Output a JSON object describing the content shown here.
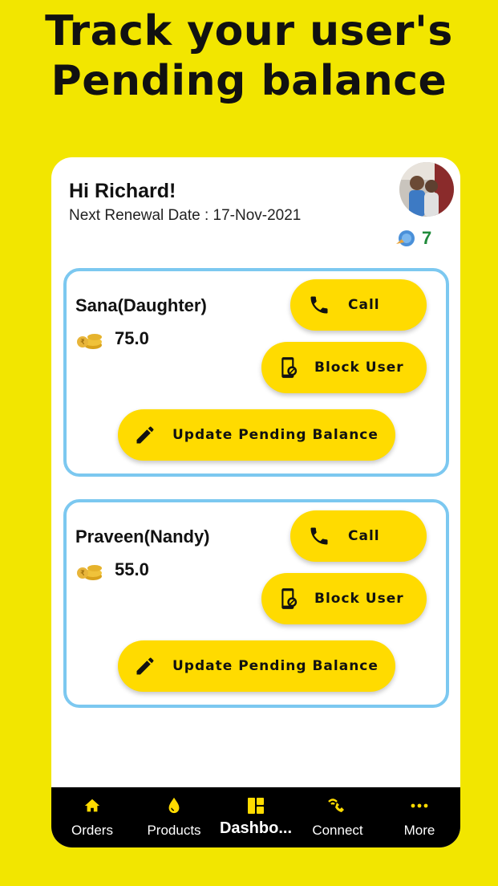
{
  "headline": {
    "line1": "Track your user's",
    "line2": "Pending balance"
  },
  "header": {
    "greeting": "Hi Richard!",
    "renewal": "Next Renewal Date : 17-Nov-2021",
    "points": "7"
  },
  "members": [
    {
      "name": "Sana(Daughter)",
      "balance": "75.0",
      "call_label": "Call",
      "block_label": "Block User",
      "update_label": "Update Pending Balance"
    },
    {
      "name": "Praveen(Nandy)",
      "balance": "55.0",
      "call_label": "Call",
      "block_label": "Block User",
      "update_label": "Update Pending Balance"
    }
  ],
  "nav": [
    {
      "label": "Orders",
      "icon": "home-icon"
    },
    {
      "label": "Products",
      "icon": "drop-icon"
    },
    {
      "label": "Dashbo...",
      "icon": "dashboard-icon",
      "active": true
    },
    {
      "label": "Connect",
      "icon": "connect-icon"
    },
    {
      "label": "More",
      "icon": "more-icon"
    }
  ],
  "colors": {
    "background": "#F2E600",
    "button": "#FFDB00",
    "card_border": "#7CC8F0",
    "points": "#1f8a3a",
    "navbar": "#000000"
  }
}
